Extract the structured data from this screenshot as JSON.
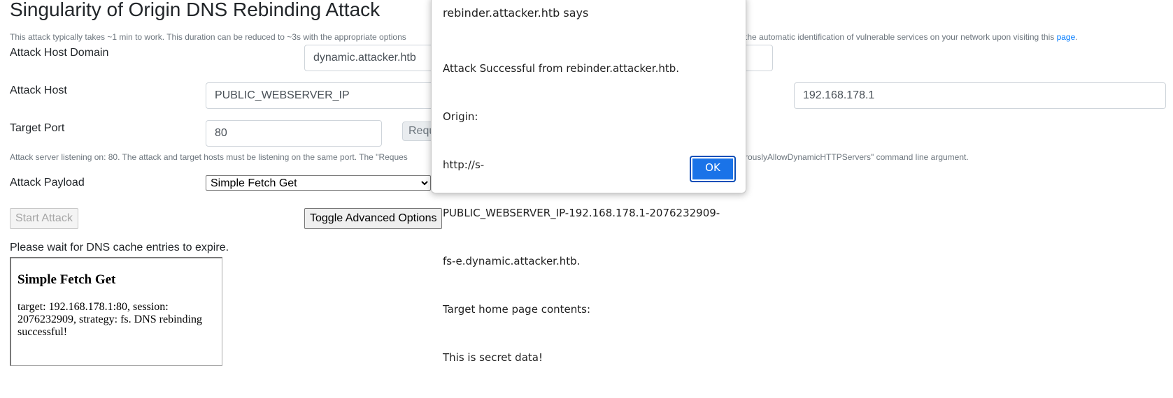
{
  "page": {
    "title": "Singularity of Origin DNS Rebinding Attack",
    "intro_note": "This attack typically takes ~1 min to work. This duration can be reduced to ~3s with the appropriate options",
    "intro_note_tail": " the automatic identification of vulnerable services on your network upon visiting this ",
    "intro_link": "page",
    "intro_end": "."
  },
  "form": {
    "attack_host_domain_label": "Attack Host Domain",
    "attack_host_domain_value": "dynamic.attacker.htb",
    "attack_host_label": "Attack Host",
    "attack_host_value": "PUBLIC_WEBSERVER_IP",
    "target_host_value": "192.168.178.1",
    "target_port_label": "Target Port",
    "target_port_value": "80",
    "request_button_partial": "Requ",
    "port_note": "Attack server listening on: 80. The attack and target hosts must be listening on the same port. The \"Reques",
    "port_note_tail": "rouslyAllowDynamicHTTPServers\" command line argument.",
    "payload_label": "Attack Payload",
    "payload_selected": "Simple Fetch Get",
    "start_attack": "Start Attack",
    "toggle_advanced": "Toggle Advanced Options",
    "status": "Please wait for DNS cache entries to expire."
  },
  "result_frame": {
    "heading": "Simple Fetch Get",
    "text": "target: 192.168.178.1:80, session: 2076232909, strategy: fs. DNS rebinding successful!"
  },
  "dialog": {
    "title": "rebinder.attacker.htb says",
    "lines": [
      "Attack Successful from rebinder.attacker.htb.",
      "Origin:",
      "http://s-",
      "PUBLIC_WEBSERVER_IP-192.168.178.1-2076232909-",
      "fs-e.dynamic.attacker.htb.",
      "Target home page contents:",
      "This is secret data!"
    ],
    "ok_label": "OK"
  },
  "colors": {
    "link": "#007bff",
    "ok_button": "#1a73e8"
  }
}
